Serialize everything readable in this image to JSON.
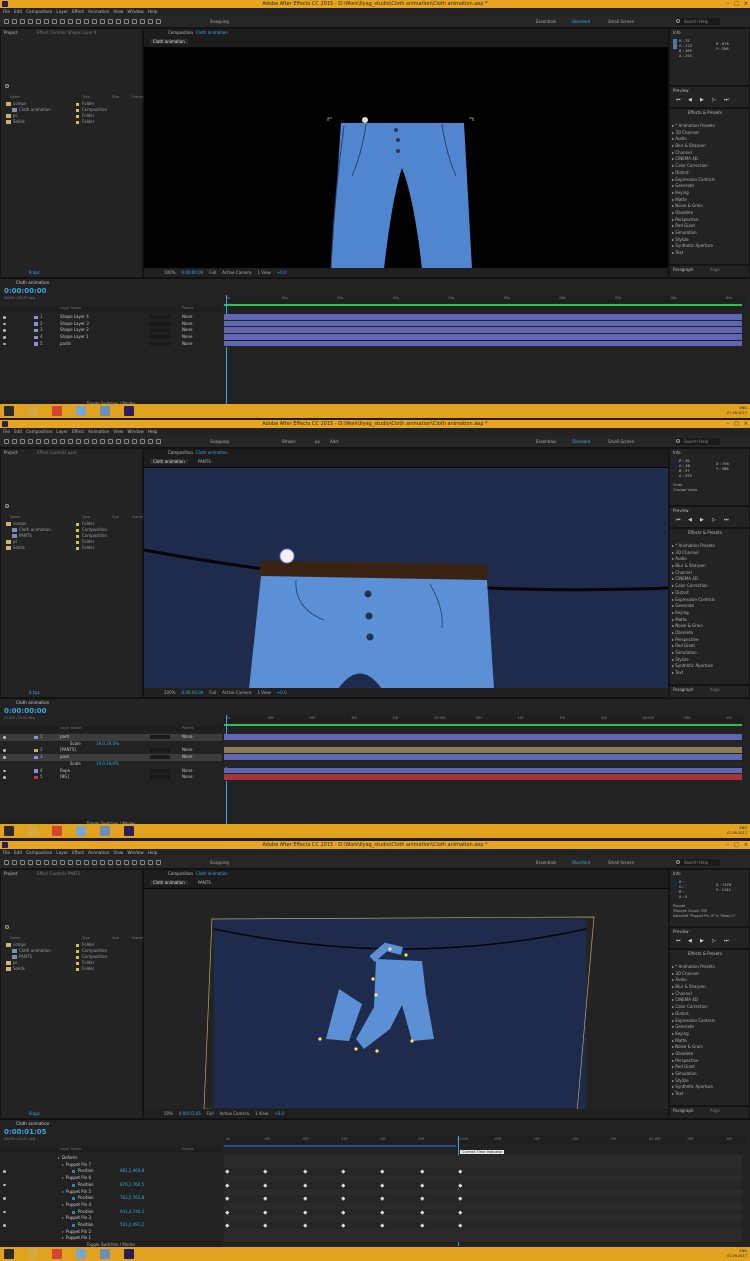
{
  "app": {
    "title": "Adobe After Effects CC 2015 - D:\\Work\\Ilyag_studio\\Cloth animation\\Cloth animation.aep *",
    "menu": [
      "File",
      "Edit",
      "Composition",
      "Layer",
      "Effect",
      "Animation",
      "View",
      "Window",
      "Help"
    ],
    "workspaces": [
      "Essentials",
      "Standard",
      "Small Screen"
    ],
    "search_placeholder": "Search Help",
    "snapping": "Snapping",
    "tools_stroke": "Stroke:",
    "tools_px": "px",
    "tools_add": "Add:"
  },
  "shots": [
    {
      "project_tab": "Project",
      "effect_tab": "Effect Controls Shape Layer 4",
      "comp_tab": "Composition",
      "comp_name": "Cloth animation",
      "comp_chip": "Cloth animation",
      "comp_chip2": "",
      "project_items": [
        {
          "name": "comps",
          "type": "Folder",
          "kind": "folder"
        },
        {
          "name": "Cloth animation",
          "type": "Composition",
          "kind": "comp"
        },
        {
          "name": "pc",
          "type": "Folder",
          "kind": "folder"
        },
        {
          "name": "Solids",
          "type": "Folder",
          "kind": "folder"
        }
      ],
      "col_name": "Name",
      "col_type": "Type",
      "col_size": "Size",
      "col_frame": "Frame",
      "bpc": "8 bpc",
      "zoom": "100%",
      "timecode_view": "0:00:00:00",
      "res": "Full",
      "camera": "Active Camera",
      "views": "1 View",
      "offset": "+0.0",
      "info_tab": "Info",
      "info_lines": [
        "R : 75",
        "G : 122",
        "B : 169",
        "A : 255"
      ],
      "info_xy": [
        "X : 676",
        "Y : 356"
      ],
      "info_extra": [],
      "preview_tab": "Preview",
      "effects_tab": "Effects & Presets",
      "effects": [
        "* Animation Presets",
        "3D Channel",
        "Audio",
        "Blur & Sharpen",
        "Channel",
        "CINEMA 4D",
        "Color Correction",
        "Distort",
        "Expression Controls",
        "Generate",
        "Keying",
        "Matte",
        "Noise & Grain",
        "Obsolete",
        "Perspective",
        "Red Giant",
        "Simulation",
        "Stylize",
        "Synthetic Aperture",
        "Text"
      ],
      "paragraph_tab": "Paragraph",
      "align_tab": "Align",
      "timeline_tab": "Cloth animation",
      "timecode": "0:00:00:00",
      "timecode_sub": "00000 (25.00 fps)",
      "layer_header": "Layer Name",
      "parent_header": "Parent",
      "layers": [
        {
          "num": "1",
          "name": "Shape Layer 4",
          "color": "#8f8fd8",
          "parent": "None",
          "kind": "layer"
        },
        {
          "num": "2",
          "name": "Shape Layer 3",
          "color": "#8f8fd8",
          "parent": "None",
          "kind": "layer"
        },
        {
          "num": "3",
          "name": "Shape Layer 2",
          "color": "#8f8fd8",
          "parent": "None",
          "kind": "layer"
        },
        {
          "num": "4",
          "name": "Shape Layer 1",
          "color": "#8f8fd8",
          "parent": "None",
          "kind": "layer"
        },
        {
          "num": "5",
          "name": "pants",
          "color": "#8f8fd8",
          "parent": "None",
          "kind": "layer"
        }
      ],
      "ruler": [
        "0s",
        "01s",
        "02s",
        "03s",
        "04s",
        "05s",
        "06s",
        "07s",
        "08s",
        "09s"
      ],
      "toggle": "Toggle Switches / Modes",
      "tooltip": "",
      "clock": [
        "ENG",
        "07.09.2017"
      ]
    },
    {
      "project_tab": "Project",
      "effect_tab": "Effect Controls pant",
      "comp_tab": "Composition",
      "comp_name": "Cloth animation",
      "comp_chip": "Cloth animation",
      "comp_chip2": "PANTS",
      "project_items": [
        {
          "name": "comps",
          "type": "Folder",
          "kind": "folder"
        },
        {
          "name": "Cloth animation",
          "type": "Composition",
          "kind": "comp"
        },
        {
          "name": "PANTS",
          "type": "Composition",
          "kind": "comp"
        },
        {
          "name": "pc",
          "type": "Folder",
          "kind": "folder"
        },
        {
          "name": "Solids",
          "type": "Folder",
          "kind": "folder"
        }
      ],
      "col_name": "Name",
      "col_type": "Type",
      "col_size": "Size",
      "col_frame": "Frame",
      "bpc": "8 bpc",
      "zoom": "200%",
      "timecode_view": "0:00:00:00",
      "res": "Full",
      "camera": "Active Camera",
      "views": "1 View",
      "offset": "+0.0",
      "info_tab": "Info",
      "info_lines": [
        "R : 28",
        "G : 36",
        "B : 57",
        "A : 255"
      ],
      "info_xy": [
        "X : 756",
        "Y : 386"
      ],
      "info_extra": [
        "Undo",
        "Change Value"
      ],
      "preview_tab": "Preview",
      "effects_tab": "Effects & Presets",
      "effects": [
        "* Animation Presets",
        "3D Channel",
        "Audio",
        "Blur & Sharpen",
        "Channel",
        "CINEMA 4D",
        "Color Correction",
        "Distort",
        "Expression Controls",
        "Generate",
        "Keying",
        "Matte",
        "Noise & Grain",
        "Obsolete",
        "Perspective",
        "Red Giant",
        "Simulation",
        "Stylize",
        "Synthetic Aperture",
        "Text"
      ],
      "paragraph_tab": "Paragraph",
      "align_tab": "Align",
      "timeline_tab": "Cloth animation",
      "timecode": "0:00:00:00",
      "timecode_sub": "00000 (25.00 fps)",
      "layer_header": "Layer Name",
      "parent_header": "Parent",
      "layers": [
        {
          "num": "1",
          "name": "pant",
          "color": "#8f8fd8",
          "parent": "None",
          "kind": "layer-sel"
        },
        {
          "num": "",
          "name": "Scale",
          "color": "",
          "parent": "",
          "kind": "prop",
          "value": "19,0,19,0%"
        },
        {
          "num": "2",
          "name": "[PANTS]",
          "color": "#c7a977",
          "parent": "None",
          "kind": "layer"
        },
        {
          "num": "3",
          "name": "pant",
          "color": "#8f8fd8",
          "parent": "None",
          "kind": "layer-sel"
        },
        {
          "num": "",
          "name": "Scale",
          "color": "",
          "parent": "",
          "kind": "prop",
          "value": "19,0,19,0%"
        },
        {
          "num": "4",
          "name": "Rope",
          "color": "#8f8fd8",
          "parent": "None",
          "kind": "layer"
        },
        {
          "num": "5",
          "name": "[BG]",
          "color": "#c83a3a",
          "parent": "None",
          "kind": "layer"
        }
      ],
      "ruler": [
        "0s",
        "00f",
        "05f",
        "10f",
        "15f",
        "01:00f",
        "05f",
        "10f",
        "15f",
        "20f",
        "02:00f",
        "05f",
        "10f"
      ],
      "toggle": "Toggle Switches / Modes",
      "tooltip": "",
      "clock": [
        "ENG",
        "07.09.2017"
      ]
    },
    {
      "project_tab": "Project",
      "effect_tab": "Effect Controls PANTS",
      "comp_tab": "Composition",
      "comp_name": "Cloth animation",
      "comp_chip": "Cloth animation",
      "comp_chip2": "PANTS",
      "project_items": [
        {
          "name": "comps",
          "type": "Folder",
          "kind": "folder"
        },
        {
          "name": "Cloth animation",
          "type": "Composition",
          "kind": "comp"
        },
        {
          "name": "PANTS",
          "type": "Composition",
          "kind": "comp"
        },
        {
          "name": "pc",
          "type": "Folder",
          "kind": "folder"
        },
        {
          "name": "Solids",
          "type": "Folder",
          "kind": "folder"
        }
      ],
      "col_name": "Name",
      "col_type": "Type",
      "col_size": "Size",
      "col_frame": "Frame",
      "bpc": "8 bpc",
      "zoom": "50%",
      "timecode_view": "0:00:01:05",
      "res": "Full",
      "camera": "Active Camera",
      "views": "1 View",
      "offset": "+0.0",
      "info_tab": "Info",
      "info_lines": [
        "R :",
        "G :",
        "B :",
        "A : 0"
      ],
      "info_xy": [
        "X : 1376",
        "Y : 1142"
      ],
      "info_extra": [
        "Puppet",
        "Triangle Count: 335",
        "Selected \"Puppet Pin 3\" in \"Mesh 1\""
      ],
      "preview_tab": "Preview",
      "effects_tab": "Effects & Presets",
      "effects": [
        "* Animation Presets",
        "3D Channel",
        "Audio",
        "Blur & Sharpen",
        "Channel",
        "CINEMA 4D",
        "Color Correction",
        "Distort",
        "Expression Controls",
        "Generate",
        "Keying",
        "Matte",
        "Noise & Grain",
        "Obsolete",
        "Perspective",
        "Red Giant",
        "Simulation",
        "Stylize",
        "Synthetic Aperture",
        "Text"
      ],
      "paragraph_tab": "Paragraph",
      "align_tab": "Align",
      "timeline_tab": "Cloth animation",
      "timecode": "0:00:01:05",
      "timecode_sub": "00030 (25.00 fps)",
      "layer_header": "Layer Name",
      "parent_header": "Parent",
      "layers": [
        {
          "num": "",
          "name": "Deform",
          "kind": "group"
        },
        {
          "num": "",
          "name": "Puppet Pin 7",
          "kind": "pin"
        },
        {
          "num": "",
          "name": "Position",
          "kind": "pos",
          "value": "981,2,464,8"
        },
        {
          "num": "",
          "name": "Puppet Pin 6",
          "kind": "pin"
        },
        {
          "num": "",
          "name": "Position",
          "kind": "pos",
          "value": "876,3,760,5"
        },
        {
          "num": "",
          "name": "Puppet Pin 5",
          "kind": "pin"
        },
        {
          "num": "",
          "name": "Position",
          "kind": "pos",
          "value": "763,5,763,8"
        },
        {
          "num": "",
          "name": "Puppet Pin 4",
          "kind": "pin"
        },
        {
          "num": "",
          "name": "Position",
          "kind": "pos",
          "value": "641,4,740,5"
        },
        {
          "num": "",
          "name": "Puppet Pin 3",
          "kind": "pin"
        },
        {
          "num": "",
          "name": "Position",
          "kind": "pos",
          "value": "541,0,491,2"
        },
        {
          "num": "",
          "name": "Puppet Pin 2",
          "kind": "pin"
        },
        {
          "num": "",
          "name": "Puppet Pin 1",
          "kind": "pin"
        }
      ],
      "ruler": [
        "0s",
        "00f",
        "05f",
        "10f",
        "15f",
        "20f",
        "01:00f",
        "05f",
        "10f",
        "15f",
        "20f",
        "02:00f",
        "05f",
        "10f"
      ],
      "toggle": "Toggle Switches / Modes",
      "tooltip": "Current Time Indicator",
      "clock": [
        "ENG",
        "07.09.2017"
      ]
    }
  ],
  "colors": {
    "accent": "#3aa7e0",
    "titlebar": "#e7a521",
    "taskbar": "#e0a21f",
    "jeans": "#4f86cf",
    "navy_bg": "#1f2b4c",
    "belt": "#3b2313",
    "track_purple": "#5f66b2",
    "track_tan": "#8e7a55",
    "track_red": "#a8353c",
    "green_bar": "#2fbf4a"
  },
  "icons": [
    "search-icon",
    "folder-icon",
    "composition-icon",
    "eye-icon",
    "play-icon",
    "windows-start-icon",
    "chrome-icon",
    "explorer-icon",
    "ae-icon",
    "hand-icon"
  ]
}
